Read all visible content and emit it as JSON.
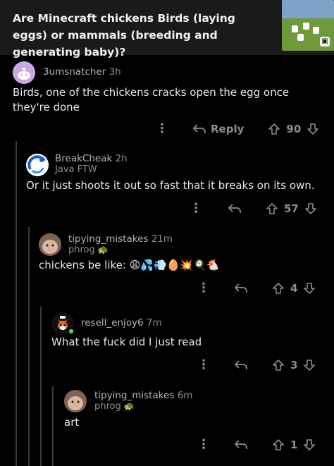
{
  "post": {
    "title": "Are Minecraft chickens Birds (laying eggs) or mammals (breeding and generating baby)?",
    "thumbnail_icon": "gallery-icon"
  },
  "comments": [
    {
      "username": "3umsnatcher",
      "time": "3h",
      "flair": "",
      "body": "Birds, one of the chickens cracks open the egg once they're done",
      "reply_label": "Reply",
      "score": "90"
    },
    {
      "username": "BreakCheak",
      "time": "2h",
      "flair": "Java FTW",
      "body": "Or it just shoots it out so fast that it breaks on its own.",
      "score": "57"
    },
    {
      "username": "tipying_mistakes",
      "time": "21m",
      "flair": "phrog",
      "flair_emoji": "🐢",
      "body": "chickens be like: 😩💦💨🥚💥🍳🐔",
      "score": "4"
    },
    {
      "username": "resell_enjoy6",
      "time": "7m",
      "flair": "",
      "body": "What the fuck did I just read",
      "score": "3"
    },
    {
      "username": "tipying_mistakes",
      "time": "6m",
      "flair": "phrog",
      "flair_emoji": "🐢",
      "body": "art",
      "score": "1"
    }
  ],
  "colors": {
    "background": "#000000",
    "header_bg": "#1a1a1b",
    "thread_line": "#3a3a3c",
    "meta_text": "#8a8d90",
    "body_text": "#e8e8e8"
  }
}
